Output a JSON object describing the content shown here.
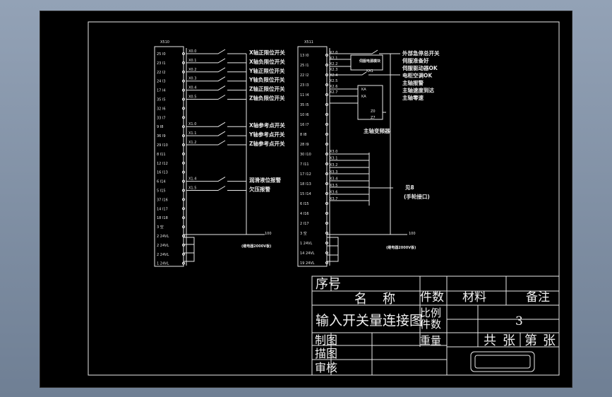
{
  "left_block": {
    "header": "X510",
    "pin_labels": [
      "25 I0",
      "23 I1",
      "22 I2",
      "24 I3",
      "17 I4",
      "35 I5",
      "32 I6",
      "33 I7",
      "9 I8",
      "36 I9",
      "29 I10",
      "8 I11",
      "12 I12",
      "16 I13",
      "6 I14",
      "5 I15",
      "37 I16",
      "14 I17",
      "18 I18",
      "3 空",
      "2 24VL",
      "2 24VL",
      "2 24VL",
      "1 24VL"
    ],
    "wire_labels": [
      "X0.0",
      "X0.1",
      "X0.2",
      "X0.3",
      "X0.4",
      "X0.5",
      "X1.0",
      "X1.1",
      "X1.2",
      "X1.4",
      "X1.5"
    ],
    "function_labels": [
      "X轴正限位开关",
      "X轴负限位开关",
      "Y轴正限位开关",
      "Y轴负限位开关",
      "Z轴正限位开关",
      "Z轴负限位开关",
      "X轴参考点开关",
      "Y轴参考点开关",
      "Z轴参考点开关",
      "润滑液位报警",
      "欠压报警"
    ],
    "wire_num": "100",
    "caption": "(继电器2000V板)"
  },
  "right_block": {
    "header": "X511",
    "pin_labels": [
      "13 I0",
      "25 I1",
      "22 I2",
      "23 I3",
      "11 I4",
      "35 I5",
      "10 I6",
      "16 I7",
      "8 I8",
      "28 I9",
      "30 I10",
      "7 I11",
      "17 I12",
      "18 I13",
      "15 I14",
      "6 I15",
      "4 I16",
      "2 I17",
      "3 空",
      "1 24VL",
      "14 24VL",
      "19 24VL"
    ],
    "wire_labels": [
      "X2.0",
      "X2.1",
      "X2.2",
      "X2.3",
      "X2.4",
      "X2.5",
      "X2.6",
      "X2.7",
      "X3.0",
      "X3.1",
      "X3.2",
      "X3.3",
      "X3.4",
      "X3.5",
      "X3.6",
      "X3.7"
    ],
    "function_labels": [
      "外部急停总开关",
      "伺服准备好",
      "伺服驱动器OK",
      "电柜空调OK",
      "主轴报警",
      "主轴速度到达",
      "主轴零速"
    ],
    "relay_labels": [
      "伺服电源模块",
      "KA1",
      "KA2"
    ],
    "converter_terminals": [
      "KA",
      "KA",
      "Z0",
      "Z3",
      "Z7"
    ],
    "converter_label": "主轴变频器",
    "bracket_label_1": "见8",
    "bracket_label_2": "(手轮接口)",
    "wire_num": "100",
    "caption": "(继电器2000V板)"
  },
  "title_block": {
    "headers": [
      "序号",
      "名称",
      "件数",
      "材料",
      "备注"
    ],
    "drawing_title": "输入开关量连接图",
    "row_labels_right": [
      "比例",
      "件数",
      "重量"
    ],
    "sheet_number": "3",
    "sheet_info": [
      "共",
      "张",
      "第",
      "张"
    ],
    "signature_labels": [
      "制图",
      "描图",
      "审核"
    ]
  }
}
